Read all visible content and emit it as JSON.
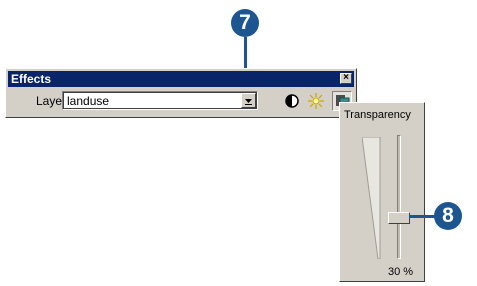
{
  "callouts": {
    "step_7": "7",
    "step_8": "8"
  },
  "colors": {
    "callout": "#1d5591",
    "titlebar": "#0a246a",
    "face": "#d4d0c8"
  },
  "window": {
    "title": "Effects",
    "close_glyph": "×",
    "layer_label": "Layer:",
    "layer_value": "landuse",
    "tools": [
      "contrast-icon",
      "brightness-icon",
      "transparency-icon"
    ]
  },
  "transparency_panel": {
    "title": "Transparency",
    "value_fraction": 0.3,
    "value_label": "30 %"
  }
}
